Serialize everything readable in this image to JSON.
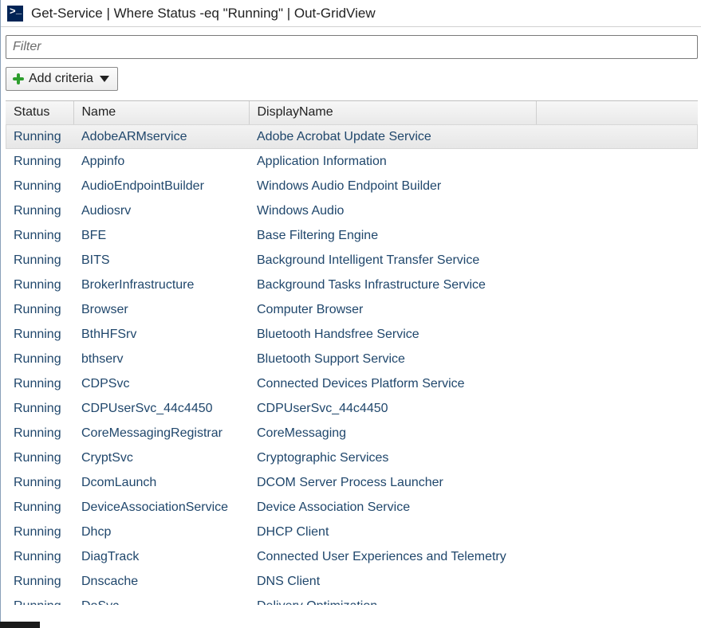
{
  "window": {
    "title": "Get-Service | Where Status -eq \"Running\" | Out-GridView"
  },
  "filter": {
    "placeholder": "Filter",
    "value": ""
  },
  "toolbar": {
    "add_criteria_label": "Add criteria"
  },
  "grid": {
    "columns": [
      "Status",
      "Name",
      "DisplayName",
      ""
    ],
    "rows": [
      {
        "status": "Running",
        "name": "AdobeARMservice",
        "display": "Adobe Acrobat Update Service",
        "selected": true
      },
      {
        "status": "Running",
        "name": "Appinfo",
        "display": "Application Information",
        "selected": false
      },
      {
        "status": "Running",
        "name": "AudioEndpointBuilder",
        "display": "Windows Audio Endpoint Builder",
        "selected": false
      },
      {
        "status": "Running",
        "name": "Audiosrv",
        "display": "Windows Audio",
        "selected": false
      },
      {
        "status": "Running",
        "name": "BFE",
        "display": "Base Filtering Engine",
        "selected": false
      },
      {
        "status": "Running",
        "name": "BITS",
        "display": "Background Intelligent Transfer Service",
        "selected": false
      },
      {
        "status": "Running",
        "name": "BrokerInfrastructure",
        "display": "Background Tasks Infrastructure Service",
        "selected": false
      },
      {
        "status": "Running",
        "name": "Browser",
        "display": "Computer Browser",
        "selected": false
      },
      {
        "status": "Running",
        "name": "BthHFSrv",
        "display": "Bluetooth Handsfree Service",
        "selected": false
      },
      {
        "status": "Running",
        "name": "bthserv",
        "display": "Bluetooth Support Service",
        "selected": false
      },
      {
        "status": "Running",
        "name": "CDPSvc",
        "display": "Connected Devices Platform Service",
        "selected": false
      },
      {
        "status": "Running",
        "name": "CDPUserSvc_44c4450",
        "display": "CDPUserSvc_44c4450",
        "selected": false
      },
      {
        "status": "Running",
        "name": "CoreMessagingRegistrar",
        "display": "CoreMessaging",
        "selected": false
      },
      {
        "status": "Running",
        "name": "CryptSvc",
        "display": "Cryptographic Services",
        "selected": false
      },
      {
        "status": "Running",
        "name": "DcomLaunch",
        "display": "DCOM Server Process Launcher",
        "selected": false
      },
      {
        "status": "Running",
        "name": "DeviceAssociationService",
        "display": "Device Association Service",
        "selected": false
      },
      {
        "status": "Running",
        "name": "Dhcp",
        "display": "DHCP Client",
        "selected": false
      },
      {
        "status": "Running",
        "name": "DiagTrack",
        "display": "Connected User Experiences and Telemetry",
        "selected": false
      },
      {
        "status": "Running",
        "name": "Dnscache",
        "display": "DNS Client",
        "selected": false
      },
      {
        "status": "Running",
        "name": "DoSvc",
        "display": "Delivery Optimization",
        "selected": false
      }
    ]
  }
}
